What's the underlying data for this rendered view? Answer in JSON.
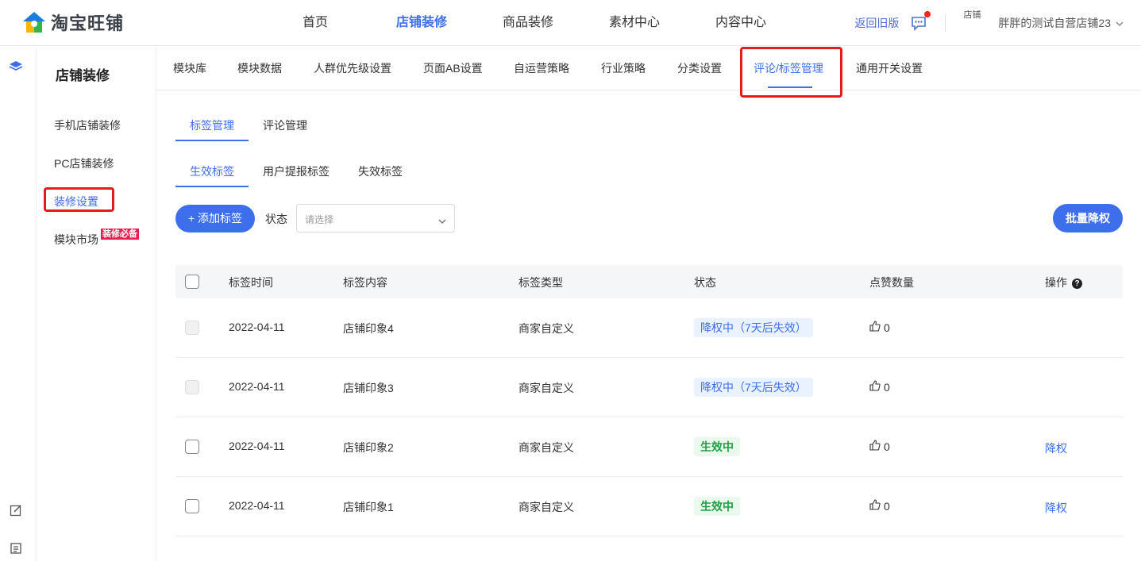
{
  "app": {
    "logo_text": "淘宝旺铺"
  },
  "topnav": {
    "items": [
      {
        "label": "首页"
      },
      {
        "label": "店铺装修"
      },
      {
        "label": "商品装修"
      },
      {
        "label": "素材中心"
      },
      {
        "label": "内容中心"
      }
    ],
    "active_index": 1,
    "back_old": "返回旧版",
    "avatar_alt": "店铺",
    "shop_name": "胖胖的测试自营店铺23"
  },
  "sidenav": {
    "title": "店铺装修",
    "items": [
      {
        "label": "手机店铺装修"
      },
      {
        "label": "PC店铺装修"
      },
      {
        "label": "装修设置"
      },
      {
        "label": "模块市场"
      }
    ],
    "badge": "装修必备"
  },
  "subnav": {
    "items": [
      {
        "label": "模块库"
      },
      {
        "label": "模块数据"
      },
      {
        "label": "人群优先级设置"
      },
      {
        "label": "页面AB设置"
      },
      {
        "label": "自运营策略"
      },
      {
        "label": "行业策略"
      },
      {
        "label": "分类设置"
      },
      {
        "label": "评论/标签管理"
      },
      {
        "label": "通用开关设置"
      }
    ]
  },
  "tabs_main": [
    {
      "label": "标签管理"
    },
    {
      "label": "评论管理"
    }
  ],
  "tabs_sub": [
    {
      "label": "生效标签"
    },
    {
      "label": "用户提报标签"
    },
    {
      "label": "失效标签"
    }
  ],
  "toolbar": {
    "add_label": "+ 添加标签",
    "status_label": "状态",
    "status_placeholder": "请选择",
    "batch_label": "批量降权"
  },
  "table": {
    "columns": [
      "标签时间",
      "标签内容",
      "标签类型",
      "状态",
      "点赞数量",
      "操作"
    ],
    "rows": [
      {
        "time": "2022-04-11",
        "content": "店铺印象4",
        "type": "商家自定义",
        "status": "降权中（7天后失效）",
        "status_kind": "down",
        "likes": "0",
        "op": ""
      },
      {
        "time": "2022-04-11",
        "content": "店铺印象3",
        "type": "商家自定义",
        "status": "降权中（7天后失效）",
        "status_kind": "down",
        "likes": "0",
        "op": ""
      },
      {
        "time": "2022-04-11",
        "content": "店铺印象2",
        "type": "商家自定义",
        "status": "生效中",
        "status_kind": "active",
        "likes": "0",
        "op": "降权"
      },
      {
        "time": "2022-04-11",
        "content": "店铺印象1",
        "type": "商家自定义",
        "status": "生效中",
        "status_kind": "active",
        "likes": "0",
        "op": "降权"
      }
    ]
  },
  "colors": {
    "accent": "#3d6fec",
    "highlight_box": "#e51c1c",
    "active_status": "#1fa043"
  }
}
